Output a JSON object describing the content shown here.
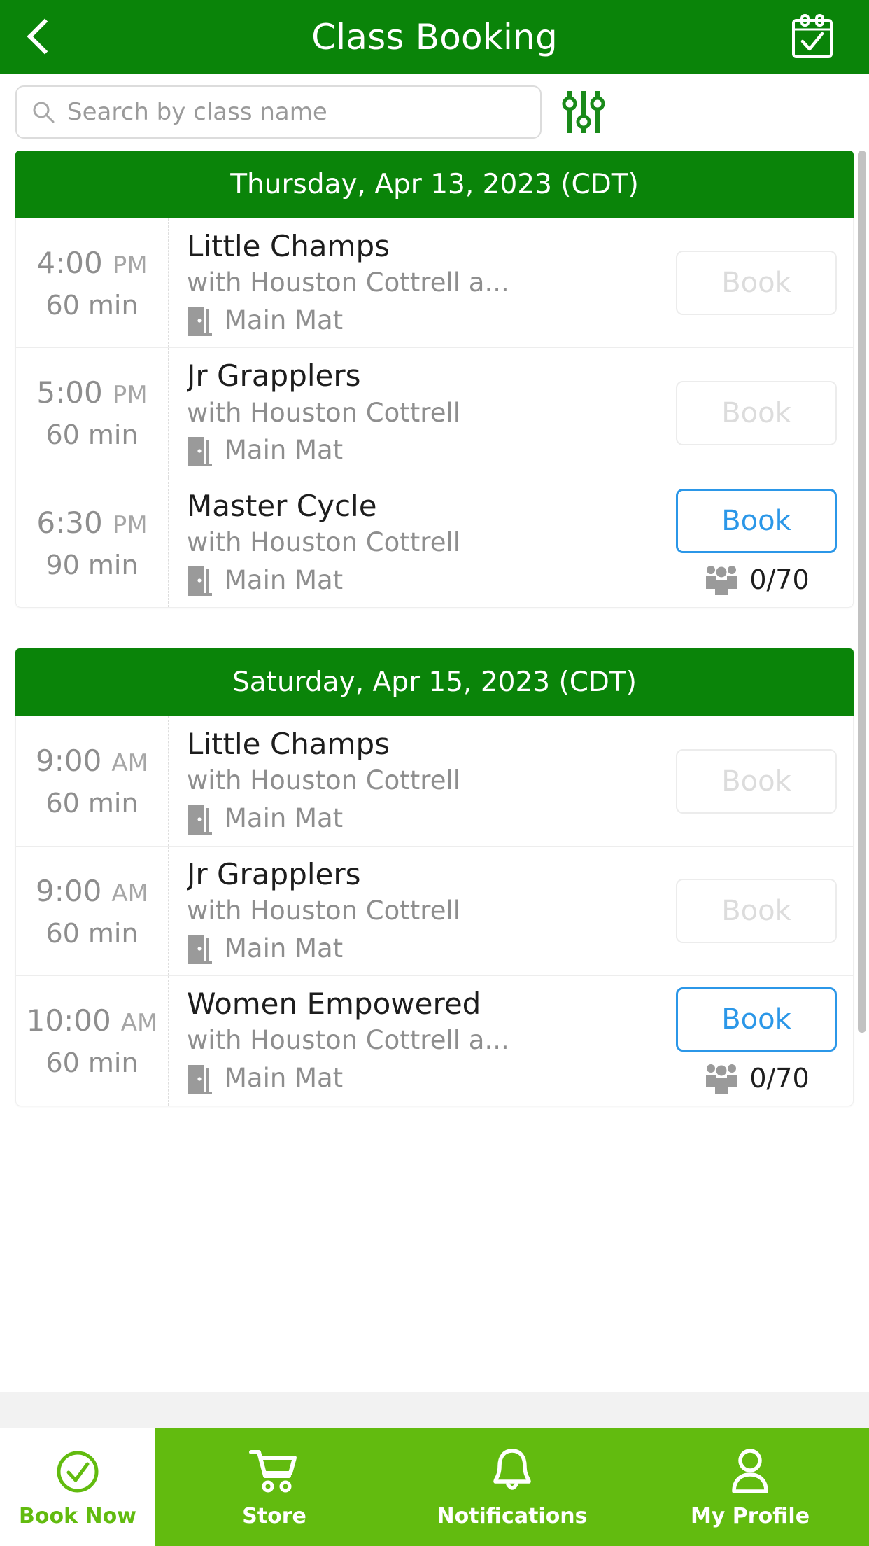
{
  "header": {
    "title": "Class Booking",
    "back_icon": "chevron-left-icon",
    "calendar_icon": "calendar-check-icon"
  },
  "search": {
    "placeholder": "Search by class name",
    "value": "",
    "icon": "search-icon",
    "filter_icon": "sliders-filter-icon"
  },
  "colors": {
    "header_green": "#0a8409",
    "nav_green": "#62bb0f",
    "book_blue": "#2b97e8",
    "muted_gray": "#8e8e8e",
    "disabled_gray": "#dcdcdc"
  },
  "day_groups": [
    {
      "date_label": "Thursday, Apr 13, 2023 (CDT)",
      "classes": [
        {
          "time": "4:00",
          "meridiem": "PM",
          "duration": "60 min",
          "name": "Little Champs",
          "instructor": "with Houston Cottrell a...",
          "room": "Main Mat",
          "room_icon": "door-room-icon",
          "book_label": "Book",
          "book_enabled": false,
          "capacity": "",
          "capacity_icon": "people-group-icon"
        },
        {
          "time": "5:00",
          "meridiem": "PM",
          "duration": "60 min",
          "name": "Jr Grapplers",
          "instructor": "with Houston Cottrell",
          "room": "Main Mat",
          "room_icon": "door-room-icon",
          "book_label": "Book",
          "book_enabled": false,
          "capacity": "",
          "capacity_icon": "people-group-icon"
        },
        {
          "time": "6:30",
          "meridiem": "PM",
          "duration": "90 min",
          "name": "Master Cycle",
          "instructor": "with Houston Cottrell",
          "room": "Main Mat",
          "room_icon": "door-room-icon",
          "book_label": "Book",
          "book_enabled": true,
          "capacity": "0/70",
          "capacity_icon": "people-group-icon"
        }
      ]
    },
    {
      "date_label": "Saturday, Apr 15, 2023 (CDT)",
      "classes": [
        {
          "time": "9:00",
          "meridiem": "AM",
          "duration": "60 min",
          "name": "Little Champs",
          "instructor": "with Houston Cottrell",
          "room": "Main Mat",
          "room_icon": "door-room-icon",
          "book_label": "Book",
          "book_enabled": false,
          "capacity": "",
          "capacity_icon": "people-group-icon"
        },
        {
          "time": "9:00",
          "meridiem": "AM",
          "duration": "60 min",
          "name": "Jr Grapplers",
          "instructor": "with Houston Cottrell",
          "room": "Main Mat",
          "room_icon": "door-room-icon",
          "book_label": "Book",
          "book_enabled": false,
          "capacity": "",
          "capacity_icon": "people-group-icon"
        },
        {
          "time": "10:00",
          "meridiem": "AM",
          "duration": "60 min",
          "name": "Women Empowered",
          "instructor": "with Houston Cottrell a...",
          "room": "Main Mat",
          "room_icon": "door-room-icon",
          "book_label": "Book",
          "book_enabled": true,
          "capacity": "0/70",
          "capacity_icon": "people-group-icon"
        }
      ]
    }
  ],
  "bottom_nav": [
    {
      "label": "Book Now",
      "icon": "check-circle-icon",
      "active": true
    },
    {
      "label": "Store",
      "icon": "shopping-cart-icon",
      "active": false
    },
    {
      "label": "Notifications",
      "icon": "bell-icon",
      "active": false
    },
    {
      "label": "My Profile",
      "icon": "user-icon",
      "active": false
    }
  ]
}
